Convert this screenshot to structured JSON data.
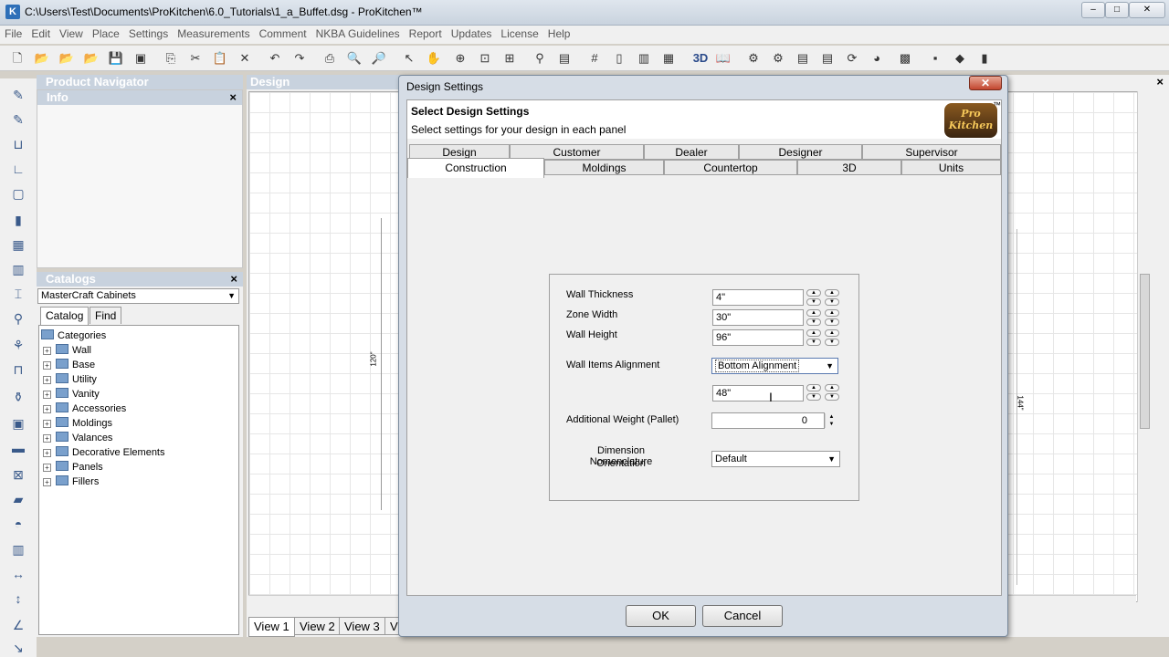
{
  "window": {
    "title": "C:\\Users\\Test\\Documents\\ProKitchen\\6.0_Tutorials\\1_a_Buffet.dsg - ProKitchen™",
    "minimize": "–",
    "maximize": "□",
    "close": "✕"
  },
  "menu": [
    "File",
    "Edit",
    "View",
    "Place",
    "Settings",
    "Measurements",
    "Comment",
    "NKBA Guidelines",
    "Report",
    "Updates",
    "License",
    "Help"
  ],
  "product_navigator": {
    "title": "Product Navigator",
    "info_title": "Info",
    "close": "×"
  },
  "catalogs": {
    "title": "Catalogs",
    "close": "×",
    "selected": "MasterCraft Cabinets",
    "tabs": [
      "Catalog",
      "Find"
    ],
    "root": "Categories",
    "items": [
      "Wall",
      "Base",
      "Utility",
      "Vanity",
      "Accessories",
      "Moldings",
      "Valances",
      "Decorative Elements",
      "Panels",
      "Fillers"
    ]
  },
  "design": {
    "title": "Design",
    "dim_left": "120\"",
    "dim_right": "144\"",
    "view_tabs": [
      "View 1",
      "View 2",
      "View 3",
      "V"
    ]
  },
  "dialog": {
    "title": "Design Settings",
    "close": "✕",
    "heading": "Select Design Settings",
    "subheading": "Select settings for your design in each panel",
    "logo_line1": "Pro",
    "logo_line2": "Kitchen",
    "logo_tm": "™",
    "tabs_row1": [
      "Design",
      "Customer",
      "Dealer",
      "Designer",
      "Supervisor"
    ],
    "tabs_row2": [
      "Construction",
      "Moldings",
      "Countertop",
      "3D",
      "Units"
    ],
    "active_tab": "Construction",
    "fields": {
      "wall_thickness": {
        "label": "Wall Thickness",
        "value": "4\""
      },
      "zone_width": {
        "label": "Zone Width",
        "value": "30\""
      },
      "wall_height": {
        "label": "Wall Height",
        "value": "96\""
      },
      "wall_items_alignment": {
        "label": "Wall Items Alignment",
        "value": "Bottom Alignment"
      },
      "alignment_height": {
        "value": "48\""
      },
      "additional_weight": {
        "label": "Additional Weight (Pallet)",
        "value": "0"
      },
      "dimension_orientation": {
        "label_line1": "Dimension Nomenclature",
        "label_line2": "Orientation",
        "value": "Default"
      }
    },
    "ok": "OK",
    "cancel": "Cancel"
  }
}
